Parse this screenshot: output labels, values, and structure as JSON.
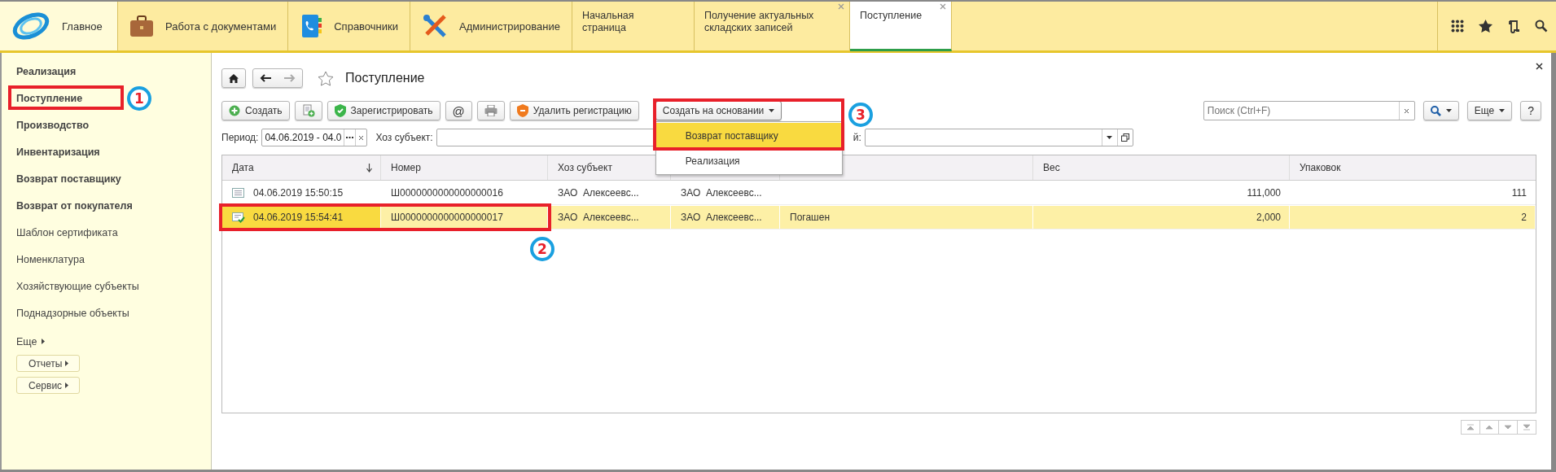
{
  "nav_sections": [
    {
      "label": "Главное",
      "kind": "home",
      "selected": true
    },
    {
      "label": "Работа с документами",
      "kind": "briefcase",
      "selected": false
    },
    {
      "label": "Справочники",
      "kind": "notebook",
      "selected": false
    },
    {
      "label": "Администрирование",
      "kind": "tools",
      "selected": false
    }
  ],
  "open_tabs": [
    {
      "label": "Начальная страница",
      "selected": false,
      "closable": false
    },
    {
      "label": "Получение актуальных складских записей",
      "selected": false,
      "closable": true
    },
    {
      "label": "Поступление",
      "selected": true,
      "closable": true
    }
  ],
  "sidebar": {
    "items": [
      {
        "label": "Реализация",
        "kind": "bold"
      },
      {
        "label": "Поступление",
        "kind": "bold"
      },
      {
        "label": "Производство",
        "kind": "bold"
      },
      {
        "label": "Инвентаризация",
        "kind": "bold"
      },
      {
        "label": "Возврат поставщику",
        "kind": "bold"
      },
      {
        "label": "Возврат от покупателя",
        "kind": "bold"
      },
      {
        "label": "Шаблон сертификата",
        "kind": "plain"
      },
      {
        "label": "Номенклатура",
        "kind": "plain"
      },
      {
        "label": "Хозяйствующие субъекты",
        "kind": "plain"
      },
      {
        "label": "Поднадзорные объекты",
        "kind": "plain"
      },
      {
        "label": "Еще",
        "kind": "more"
      },
      {
        "label": "Отчеты",
        "kind": "button"
      },
      {
        "label": "Сервис",
        "kind": "button"
      }
    ]
  },
  "form": {
    "title": "Поступление",
    "toolbar": [
      {
        "kind": "create",
        "label": "Создать"
      },
      {
        "kind": "copy"
      },
      {
        "kind": "register",
        "label": "Зарегистрировать"
      },
      {
        "kind": "at",
        "label": "@"
      },
      {
        "kind": "print"
      },
      {
        "kind": "unregister",
        "label": "Удалить регистрацию"
      },
      {
        "kind": "dropdown",
        "label": "Создать на основании"
      }
    ],
    "menu": [
      {
        "label": "Возврат поставщику",
        "selected": true
      },
      {
        "label": "Реализация",
        "selected": false
      }
    ],
    "search": {
      "placeholder": "Поиск (Ctrl+F)"
    },
    "more_button": "Еще",
    "help_button": "?",
    "filters": [
      {
        "label": "Период:",
        "value": "04.06.2019 - 04.0",
        "kind": "period"
      },
      {
        "label": "Хоз субъект:",
        "kind": "select"
      },
      {
        "label": "й:",
        "kind": "select"
      }
    ],
    "table": {
      "columns": [
        {
          "label": "Дата",
          "sorted_descending": true,
          "right_aligned": false
        },
        {
          "label": "Номер",
          "right_aligned": false
        },
        {
          "label": "Хоз субъект",
          "right_aligned": false
        },
        {
          "right_aligned": false
        },
        {
          "right_aligned": false
        },
        {
          "label": "Вес",
          "right_aligned": true
        },
        {
          "label": "Упаковок",
          "right_aligned": true
        }
      ],
      "rows": [
        {
          "posted": false,
          "selected": false,
          "cells": [
            "04.06.2019 15:50:15",
            "Ш0000000000000000016",
            "ЗАО  Алексеевс...",
            "ЗАО  Алексеевс...",
            null,
            "111,000",
            "111"
          ]
        },
        {
          "posted": true,
          "selected": true,
          "cells": [
            "04.06.2019 15:54:41",
            "Ш0000000000000000017",
            "ЗАО  Алексеевс...",
            "ЗАО  Алексеевс...",
            "Погашен",
            "2,000",
            "2"
          ]
        }
      ]
    }
  },
  "annotations": [
    {
      "label": "1"
    },
    {
      "label": "2"
    },
    {
      "label": "3"
    }
  ]
}
